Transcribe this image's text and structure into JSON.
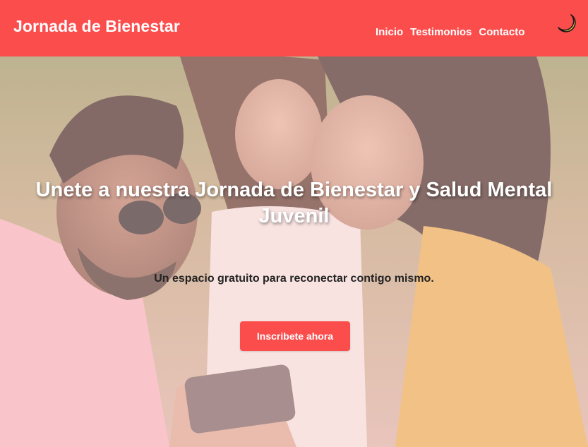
{
  "header": {
    "brand": "Jornada de Bienestar",
    "nav": [
      {
        "label": "Inicio"
      },
      {
        "label": "Testimonios"
      },
      {
        "label": "Contacto"
      }
    ],
    "theme_toggle_icon": "crescent-moon-icon",
    "background_color": "#fc4d4d"
  },
  "hero": {
    "title": "Unete a nuestra Jornada de Bienestar y Salud Mental Juvenil",
    "subtitle": "Un espacio gratuito para reconectar contigo mismo.",
    "cta_label": "Inscribete ahora",
    "background_image": "group-of-young-people-smiling-at-phone"
  },
  "colors": {
    "accent": "#fc4d4d",
    "text_dark": "#222222",
    "text_light": "#ffffff"
  }
}
